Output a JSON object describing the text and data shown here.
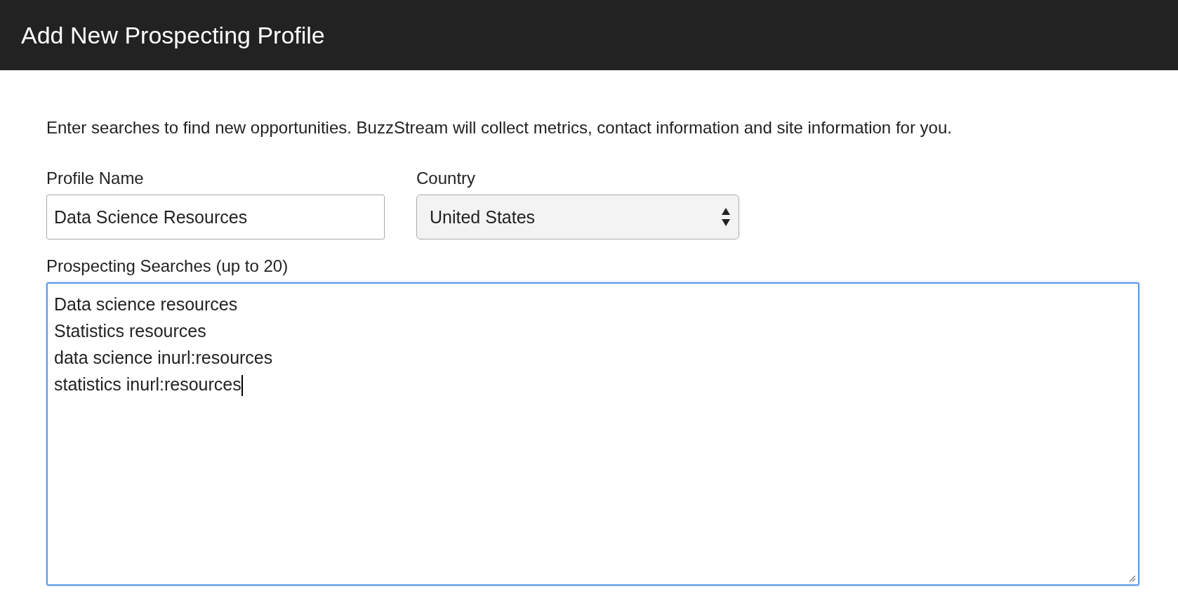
{
  "header": {
    "title": "Add New Prospecting Profile"
  },
  "intro": "Enter searches to find new opportunities. BuzzStream will collect metrics, contact information and site information for you.",
  "profile_name": {
    "label": "Profile Name",
    "value": "Data Science Resources"
  },
  "country": {
    "label": "Country",
    "value": "United States"
  },
  "searches": {
    "label": "Prospecting Searches (up to 20)",
    "focused": true,
    "lines": [
      "Data science resources",
      "Statistics resources",
      "data science inurl:resources",
      "statistics inurl:resources"
    ]
  }
}
